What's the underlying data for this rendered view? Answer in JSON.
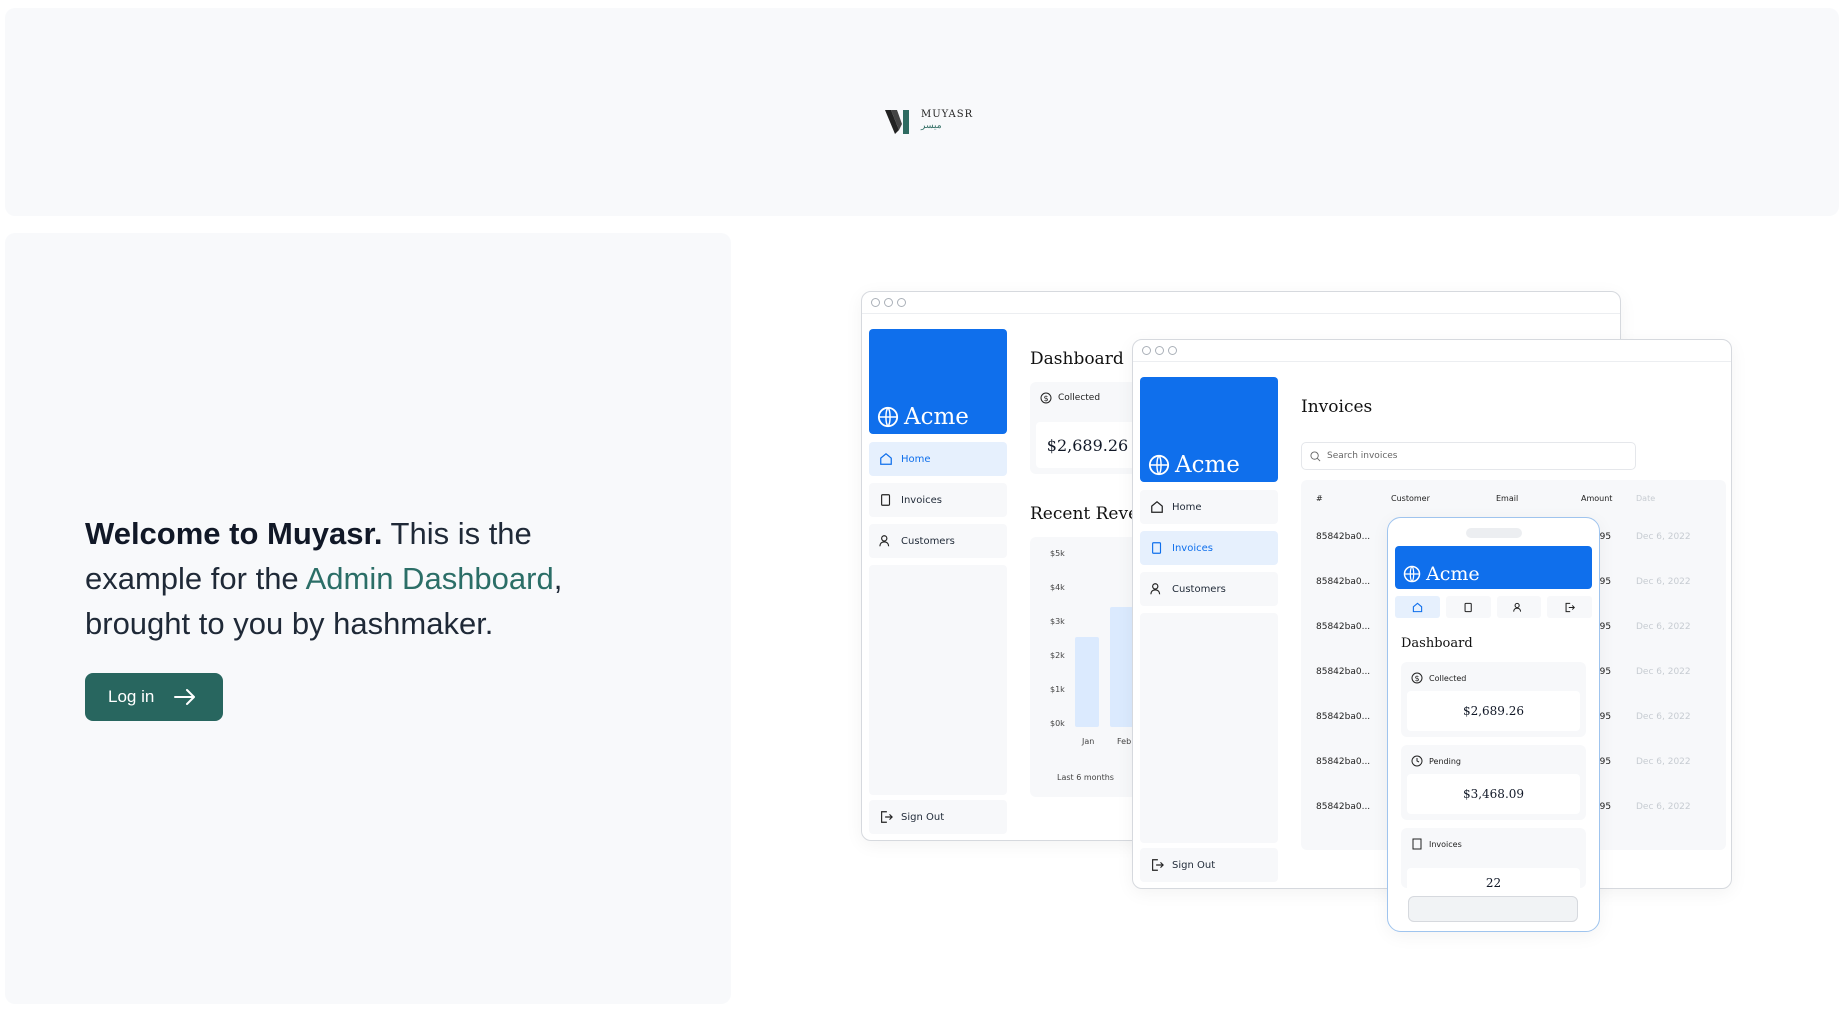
{
  "header": {
    "logo_word": "MUYASR",
    "logo_arabic": "ميسر"
  },
  "hero": {
    "bold": "Welcome to Muyasr.",
    "text1": " This is the example for the ",
    "link": "Admin Dashboard",
    "text2": ", brought to you by hashmaker.",
    "login_label": "Log in"
  },
  "mockup": {
    "brand": "Acme",
    "desktop": {
      "title": "Dashboard",
      "nav": [
        "Home",
        "Invoices",
        "Customers"
      ],
      "sign_out": "Sign Out",
      "collected_label": "Collected",
      "collected_value": "$2,689.26",
      "revenue_title": "Recent Revenu",
      "yticks": [
        "$5k",
        "$4k",
        "$3k",
        "$2k",
        "$1k",
        "$0k"
      ],
      "months": [
        "Jan",
        "Feb"
      ],
      "footnote": "Last 6 months"
    },
    "tablet": {
      "title": "Invoices",
      "nav": [
        "Home",
        "Invoices",
        "Customers"
      ],
      "sign_out": "Sign Out",
      "search_placeholder": "Search invoices",
      "columns": [
        "#",
        "Customer",
        "Email",
        "Amount",
        "Date"
      ],
      "rows": [
        {
          "id": "85842ba0...",
          "amount": "7.95",
          "date": "Dec 6, 2022"
        },
        {
          "id": "85842ba0...",
          "amount": "7.95",
          "date": "Dec 6, 2022"
        },
        {
          "id": "85842ba0...",
          "amount": "7.95",
          "date": "Dec 6, 2022"
        },
        {
          "id": "85842ba0...",
          "amount": "7.95",
          "date": "Dec 6, 2022"
        },
        {
          "id": "85842ba0...",
          "amount": "7.95",
          "date": "Dec 6, 2022"
        },
        {
          "id": "85842ba0...",
          "amount": "7.95",
          "date": "Dec 6, 2022"
        },
        {
          "id": "85842ba0...",
          "amount": "7.95",
          "date": "Dec 6, 2022"
        }
      ]
    },
    "phone": {
      "title": "Dashboard",
      "cards": [
        {
          "label": "Collected",
          "value": "$2,689.26"
        },
        {
          "label": "Pending",
          "value": "$3,468.09"
        },
        {
          "label": "Invoices",
          "value": "22"
        }
      ]
    }
  }
}
